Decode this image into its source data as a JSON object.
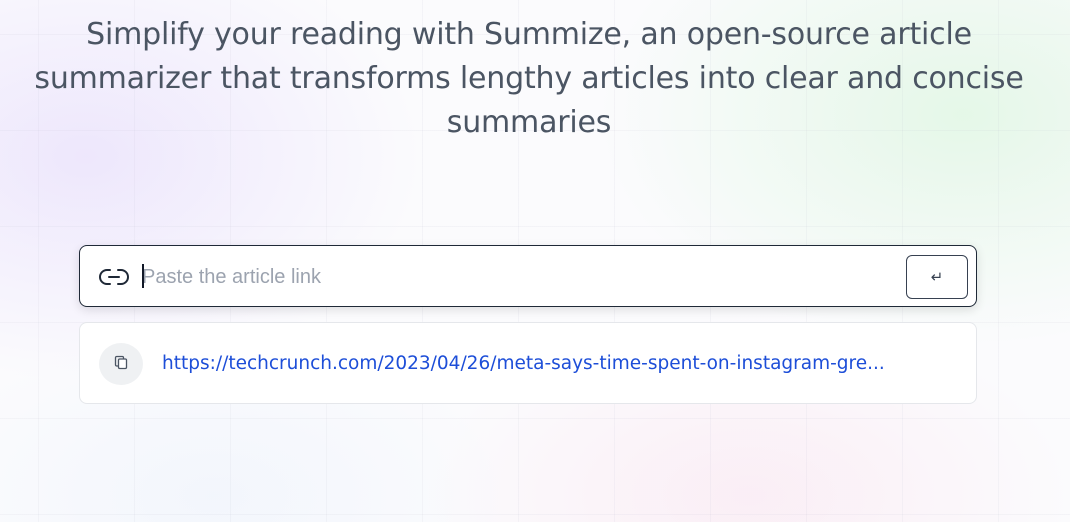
{
  "hero": {
    "tagline": "Simplify your reading with Summize, an open-source article summarizer that transforms lengthy articles into clear and concise summaries"
  },
  "search": {
    "icon": "link-icon",
    "placeholder": "Paste the article link",
    "value": "",
    "submit_label": "↵"
  },
  "history": {
    "items": [
      {
        "icon": "copy-icon",
        "url": "https://techcrunch.com/2023/04/26/meta-says-time-spent-on-instagram-gre..."
      }
    ]
  },
  "colors": {
    "url_link": "#1d4ed8",
    "tagline_text": "#4b5563",
    "input_border": "#1f2937"
  }
}
